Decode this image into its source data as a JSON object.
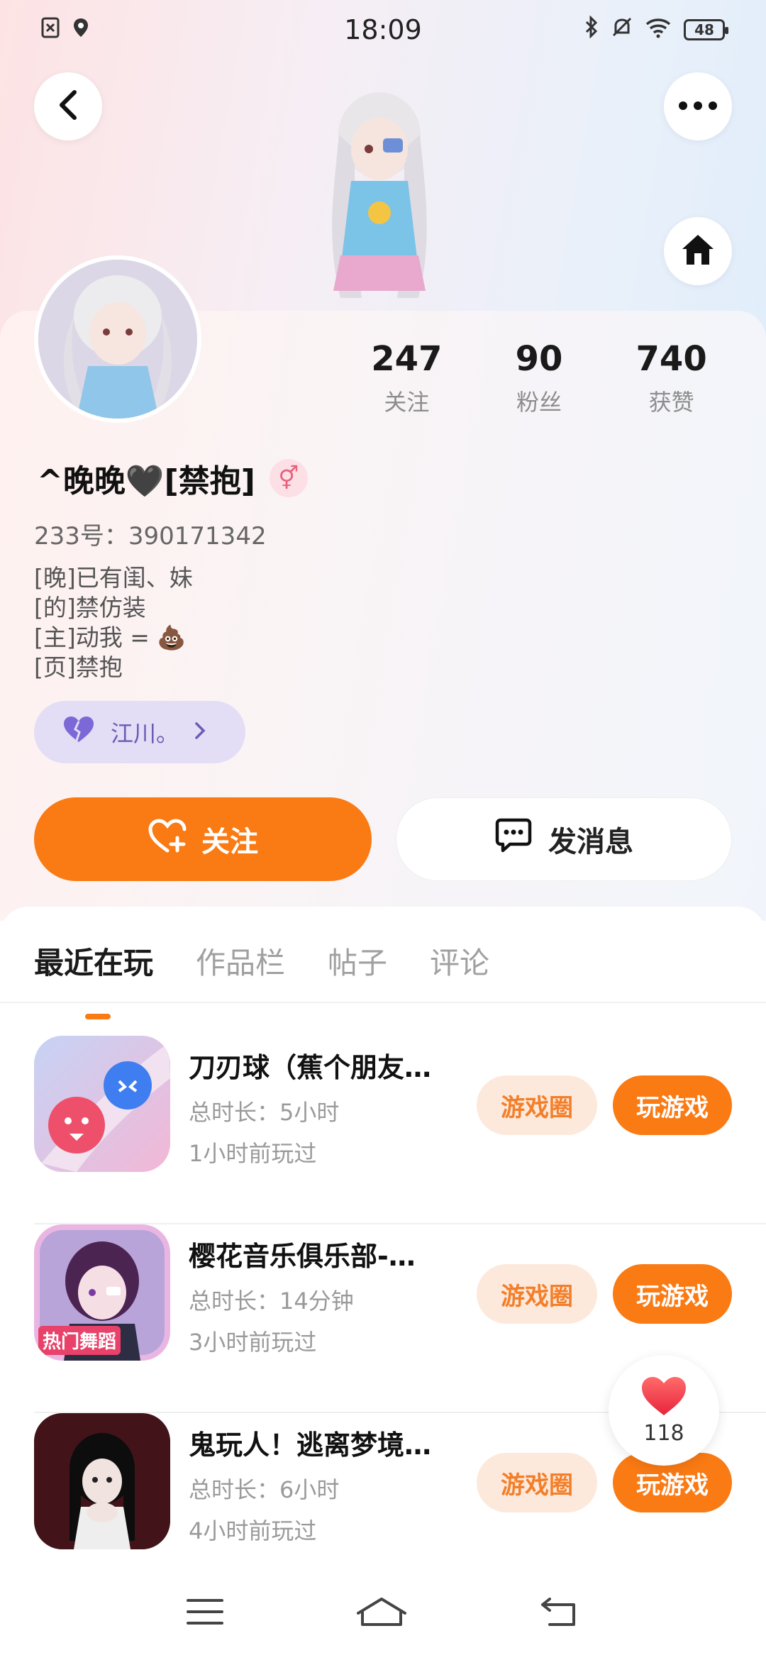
{
  "status_bar": {
    "time": "18:09",
    "battery": "48",
    "left_icons": [
      "sim-icon",
      "location-icon"
    ],
    "right_icons": [
      "bluetooth-icon",
      "mute-icon",
      "wifi-icon",
      "battery-icon"
    ]
  },
  "header": {
    "back_icon": "back-icon",
    "more_icon": "more-icon",
    "home_icon": "home-icon"
  },
  "profile": {
    "nickname": "^晚晚🖤[禁抱]",
    "gender_symbol": "⚥",
    "uid": "233号：390171342",
    "bio_lines": [
      "[晚]已有闺、妹",
      "[的]禁仿装",
      "[主]动我 = 💩",
      "[页]禁抱"
    ],
    "stats": [
      {
        "value": "247",
        "label": "关注"
      },
      {
        "value": "90",
        "label": "粉丝"
      },
      {
        "value": "740",
        "label": "获赞"
      }
    ],
    "relation": {
      "label": "江川。"
    }
  },
  "actions": {
    "follow_label": "关注",
    "message_label": "发消息"
  },
  "tabs": [
    {
      "label": "最近在玩",
      "active": true
    },
    {
      "label": "作品栏",
      "active": false
    },
    {
      "label": "帖子",
      "active": false
    },
    {
      "label": "评论",
      "active": false
    }
  ],
  "games": [
    {
      "title": "刀刃球（蕉个朋友…",
      "duration": "总时长：5小时",
      "last_played": "1小时前玩过",
      "circle_label": "游戏圈",
      "play_label": "玩游戏"
    },
    {
      "title": "樱花音乐俱乐部-…",
      "duration": "总时长：14分钟",
      "last_played": "3小时前玩过",
      "circle_label": "游戏圈",
      "play_label": "玩游戏",
      "icon_badge": "热门舞蹈"
    },
    {
      "title": "鬼玩人！逃离梦境…",
      "duration": "总时长：6小时",
      "last_played": "4小时前玩过",
      "circle_label": "游戏圈",
      "play_label": "玩游戏"
    }
  ],
  "like_float": {
    "count": "118"
  },
  "colors": {
    "accent": "#fa7a14",
    "circle_bg": "#fde9dc",
    "relation_bg": "#e3def6"
  }
}
